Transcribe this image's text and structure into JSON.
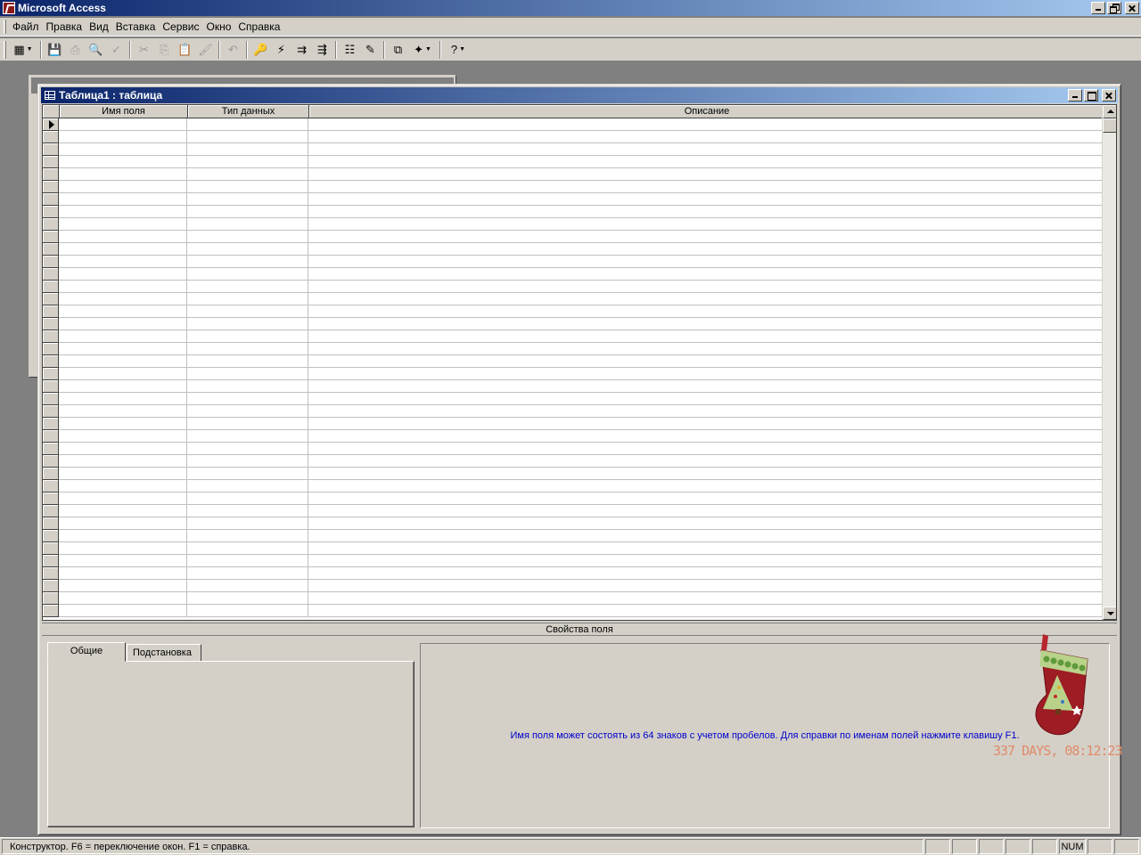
{
  "app": {
    "title": "Microsoft Access"
  },
  "menu": {
    "items": [
      {
        "label": "Файл",
        "key": "Ф"
      },
      {
        "label": "Правка",
        "key": "П"
      },
      {
        "label": "Вид",
        "key": "В"
      },
      {
        "label": "Вставка",
        "key": "с"
      },
      {
        "label": "Сервис",
        "key": "С"
      },
      {
        "label": "Окно",
        "key": "О"
      },
      {
        "label": "Справка",
        "key": "С"
      }
    ]
  },
  "toolbar": {
    "buttons": [
      {
        "icon": "view-icon",
        "glyph": "▦",
        "enabled": true
      },
      {
        "icon": "save-icon",
        "glyph": "💾",
        "enabled": true
      },
      {
        "icon": "print-icon",
        "glyph": "⎙",
        "enabled": false
      },
      {
        "icon": "print-preview-icon",
        "glyph": "🔍",
        "enabled": false
      },
      {
        "icon": "spelling-icon",
        "glyph": "✓",
        "enabled": false
      },
      {
        "icon": "cut-icon",
        "glyph": "✂",
        "enabled": false
      },
      {
        "icon": "copy-icon",
        "glyph": "⎘",
        "enabled": false
      },
      {
        "icon": "paste-icon",
        "glyph": "📋",
        "enabled": true
      },
      {
        "icon": "format-painter-icon",
        "glyph": "🖌",
        "enabled": false
      },
      {
        "icon": "undo-icon",
        "glyph": "↶",
        "enabled": false
      },
      {
        "icon": "primary-key-icon",
        "glyph": "🔑",
        "enabled": true
      },
      {
        "icon": "indexes-icon",
        "glyph": "⚡",
        "enabled": true
      },
      {
        "icon": "insert-rows-icon",
        "glyph": "⇉",
        "enabled": true
      },
      {
        "icon": "delete-rows-icon",
        "glyph": "⇶",
        "enabled": true
      },
      {
        "icon": "properties-icon",
        "glyph": "☷",
        "enabled": true
      },
      {
        "icon": "build-icon",
        "glyph": "✎",
        "enabled": true
      },
      {
        "icon": "database-window-icon",
        "glyph": "⧉",
        "enabled": true
      },
      {
        "icon": "new-object-icon",
        "glyph": "✦",
        "enabled": true
      },
      {
        "icon": "help-icon",
        "glyph": "?",
        "enabled": true
      }
    ]
  },
  "child": {
    "title": "Таблица1 : таблица"
  },
  "grid": {
    "columns": [
      "Имя поля",
      "Тип данных",
      "Описание"
    ],
    "row_count": 40
  },
  "properties": {
    "header": "Свойства поля",
    "tabs": [
      "Общие",
      "Подстановка"
    ],
    "help_text": "Имя поля может состоять из 64 знаков с учетом пробелов.  Для справки по именам полей нажмите клавишу F1."
  },
  "decoration": {
    "countdown": "337 DAYS, 08:12:23"
  },
  "status": {
    "text": "Конструктор.  F6 = переключение окон.  F1 = справка.",
    "indicators": [
      "",
      "",
      "",
      "",
      "",
      "NUM",
      "",
      ""
    ]
  },
  "colors": {
    "title_gradient_start": "#0a246a",
    "title_gradient_end": "#a6caf0",
    "face": "#d4d0c8",
    "help_text": "#0000cc"
  }
}
